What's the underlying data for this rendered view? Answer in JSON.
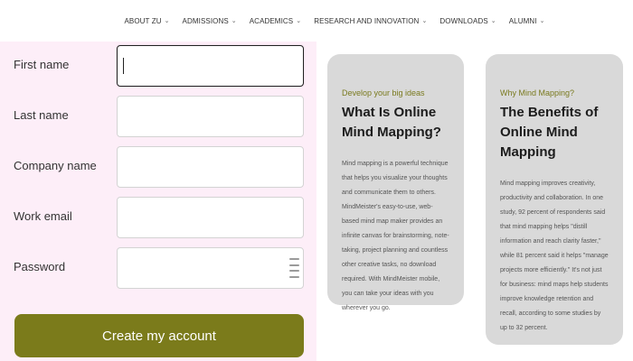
{
  "nav": {
    "items": [
      {
        "label": "ABOUT ZU",
        "has_dropdown": true
      },
      {
        "label": "ADMISSIONS",
        "has_dropdown": true
      },
      {
        "label": "ACADEMICS",
        "has_dropdown": true
      },
      {
        "label": "RESEARCH AND INNOVATION",
        "has_dropdown": true
      },
      {
        "label": "DOWNLOADS",
        "has_dropdown": true
      },
      {
        "label": "ALUMNI",
        "has_dropdown": true
      }
    ]
  },
  "form": {
    "fields": [
      {
        "label": "First name",
        "value": "",
        "focused": true
      },
      {
        "label": "Last name",
        "value": ""
      },
      {
        "label": "Company name",
        "value": ""
      },
      {
        "label": "Work email",
        "value": ""
      },
      {
        "label": "Password",
        "value": ""
      }
    ],
    "submit_label": "Create my account"
  },
  "cards": [
    {
      "eyebrow": "Develop your big ideas",
      "title": "What Is Online Mind Mapping?",
      "body": "Mind mapping is a powerful technique that helps you visualize your thoughts and communicate them to others. MindMeister's easy-to-use, web-based mind map maker provides an infinite canvas for brainstorming, note-taking, project planning and countless other creative tasks, no download required. With MindMeister mobile, you can take your ideas with you wherever you go."
    },
    {
      "eyebrow": "Why Mind Mapping?",
      "title": "The Benefits of Online Mind Mapping",
      "body": "Mind mapping improves creativity, productivity and collaboration. In one study, 92 percent of respondents said that mind mapping helps \"distill information and reach clarity faster,\" while 81 percent said it helps \"manage projects more efficiently.\" It's not just for business: mind maps help students improve knowledge retention and recall, according to some studies by up to 32 percent."
    }
  ],
  "colors": {
    "panel_bg": "#fdeef8",
    "button_bg": "#7b7b1b",
    "card_bg": "#d9d9d9",
    "eyebrow": "#7a7a1f"
  }
}
